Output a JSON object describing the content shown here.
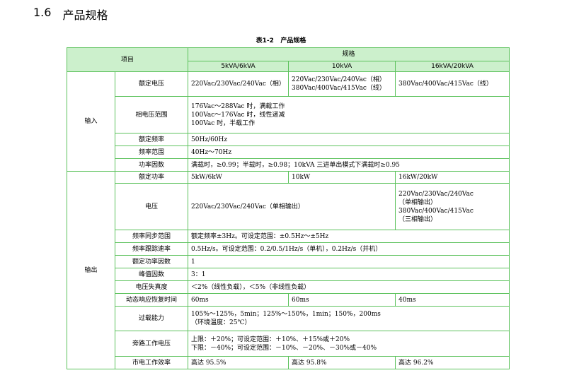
{
  "section": {
    "number": "1.6",
    "title": "产品规格"
  },
  "caption": "表1-2   产品规格",
  "header": {
    "item": "项目",
    "spec": "规格",
    "models": [
      "5kVA/6kVA",
      "10kVA",
      "16kVA/20kVA"
    ]
  },
  "input": {
    "category": "输入",
    "rated_voltage": {
      "label": "额定电压",
      "v1": "220Vac/230Vac/240Vac（相）",
      "v2": [
        "220Vac/230Vac/240Vac（相）",
        "380Vac/400Vac/415Vac（线）"
      ],
      "v3": "380Vac/400Vac/415Vac（线）"
    },
    "phase_voltage_range": {
      "label": "相电压范围",
      "lines": [
        "176Vac～288Vac 时，满载工作",
        "100Vac～176Vac 时，线性递减",
        "100Vac 时，半载工作"
      ]
    },
    "rated_frequency": {
      "label": "额定频率",
      "value": "50Hz/60Hz"
    },
    "frequency_range": {
      "label": "频率范围",
      "value": "40Hz～70Hz"
    },
    "power_factor": {
      "label": "功率因数",
      "value": "满载时，≥0.99；半载时，≥0.98；10kVA 三进单出模式下满载时≥0.95"
    }
  },
  "output": {
    "category": "输出",
    "rated_power": {
      "label": "额定功率",
      "v1": "5kW/6kW",
      "v2": "10kW",
      "v3": "16kW/20kW"
    },
    "voltage": {
      "label": "电压",
      "v12": "220Vac/230Vac/240Vac（单相输出）",
      "v3": [
        "220Vac/230Vac/240Vac",
        "（单相输出）",
        "380Vac/400Vac/415Vac",
        "（三相输出）"
      ]
    },
    "freq_sync_range": {
      "label": "频率同步范围",
      "value": "额定频率±3Hz。可设定范围：±0.5Hz～±5Hz"
    },
    "freq_slew_rate": {
      "label": "频率跟踪速率",
      "value": "0.5Hz/s。可设定范围：0.2/0.5/1Hz/s（单机），0.2Hz/s（并机）"
    },
    "rated_pf": {
      "label": "额定功率因数",
      "value": "1"
    },
    "crest_factor": {
      "label": "峰值因数",
      "value": "3：1"
    },
    "thd": {
      "label": "电压失真度",
      "value": "＜2%（线性负载），＜5%（非线性负载）"
    },
    "dynamic_recovery": {
      "label": "动态响应恢复时间",
      "v1": "60ms",
      "v2": "60ms",
      "v3": "40ms"
    },
    "overload": {
      "label": "过载能力",
      "lines": [
        "105%～125%，5min；125%～150%，1min；150%，200ms",
        "（环境温度：25℃）"
      ]
    },
    "bypass_voltage": {
      "label": "旁路工作电压",
      "lines": [
        "上限：＋20%；可设定范围：＋10%、＋15%或＋20%",
        "下限：－40%；可设定范围：－10%、－20%、－30%或－40%"
      ]
    },
    "efficiency": {
      "label": "市电工作效率",
      "v1": "高达 95.5%",
      "v2": "高达 95.8%",
      "v3": "高达 96.2%"
    }
  }
}
